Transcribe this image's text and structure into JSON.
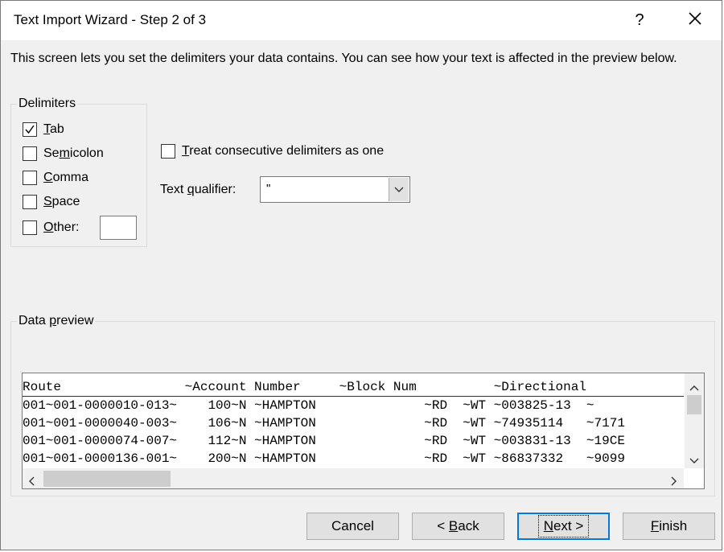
{
  "window": {
    "title": "Text Import Wizard - Step 2 of 3",
    "help_label": "?"
  },
  "description": "This screen lets you set the delimiters your data contains.  You can see how your text is affected in the preview below.",
  "delimiters": {
    "group_label": "Delimiters",
    "options": [
      {
        "label_pre": "",
        "accel": "T",
        "label_post": "ab",
        "checked": true
      },
      {
        "label_pre": "Se",
        "accel": "m",
        "label_post": "icolon",
        "checked": false
      },
      {
        "label_pre": "",
        "accel": "C",
        "label_post": "omma",
        "checked": false
      },
      {
        "label_pre": "",
        "accel": "S",
        "label_post": "pace",
        "checked": false
      },
      {
        "label_pre": "",
        "accel": "O",
        "label_post": "ther:",
        "checked": false
      }
    ],
    "other_value": ""
  },
  "consecutive": {
    "accel": "T",
    "label_post": "reat consecutive delimiters as one",
    "checked": false
  },
  "text_qualifier": {
    "label_pre": "Text ",
    "accel": "q",
    "label_post": "ualifier:",
    "value": "\""
  },
  "preview": {
    "group_label_pre": "Data ",
    "group_accel": "p",
    "group_label_post": "review",
    "header": "Route                ~Account Number     ~Block Num          ~Directional",
    "rows": [
      "001~001-0000010-013~    100~N ~HAMPTON              ~RD  ~WT ~003825-13  ~",
      "001~001-0000040-003~    106~N ~HAMPTON              ~RD  ~WT ~74935114   ~7171",
      "001~001-0000074-007~    112~N ~HAMPTON              ~RD  ~WT ~003831-13  ~19CE",
      "001~001-0000136-001~    200~N ~HAMPTON              ~RD  ~WT ~86837332   ~9099"
    ]
  },
  "buttons": {
    "cancel": "Cancel",
    "back_pre": "< ",
    "back_accel": "B",
    "back_post": "ack",
    "next_accel": "N",
    "next_post": "ext >",
    "finish_accel": "F",
    "finish_post": "inish"
  },
  "icons": {
    "close": "close-icon",
    "check": "checkmark-icon",
    "dropdown": "chevron-down-icon"
  }
}
